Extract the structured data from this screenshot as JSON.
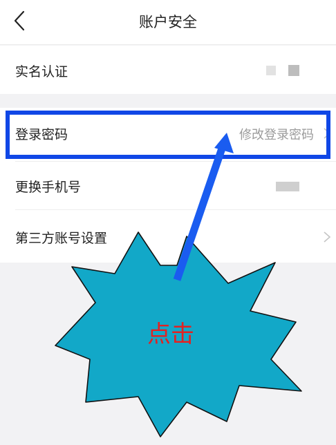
{
  "nav": {
    "title": "账户安全",
    "back_icon": "chevron-left-icon"
  },
  "settings": {
    "items": [
      {
        "label": "实名认证"
      },
      {
        "label": "登录密码",
        "hint": "修改登录密码"
      },
      {
        "label": "更换手机号"
      },
      {
        "label": "第三方账号设置"
      }
    ]
  },
  "annotation": {
    "burst_text": "点击",
    "highlight_color": "#1047e6",
    "arrow_color": "#1a5cf0",
    "burst_fill": "#12a8c8",
    "burst_text_color": "#e32121"
  }
}
